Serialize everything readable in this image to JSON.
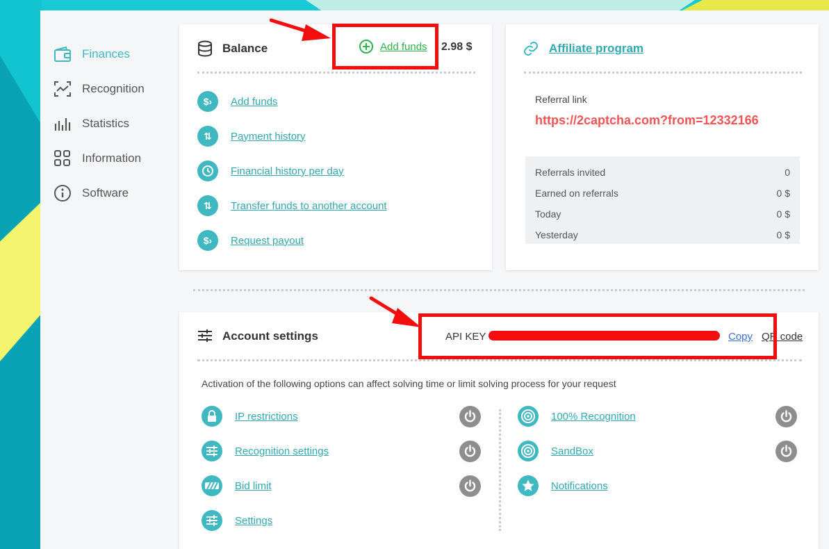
{
  "sidebar": {
    "items": [
      {
        "label": "Finances",
        "icon": "wallet-icon",
        "active": true
      },
      {
        "label": "Recognition",
        "icon": "recognition-icon",
        "active": false
      },
      {
        "label": "Statistics",
        "icon": "bar-chart-icon",
        "active": false
      },
      {
        "label": "Information",
        "icon": "grid-icon",
        "active": false
      },
      {
        "label": "Software",
        "icon": "info-icon",
        "active": false
      }
    ]
  },
  "balance": {
    "title": "Balance",
    "add_funds_label": "Add funds",
    "amount": "2.98 $",
    "links": [
      "Add funds",
      "Payment history",
      "Financial history per day",
      "Transfer funds to another account",
      "Request payout"
    ]
  },
  "affiliate": {
    "title": "Affiliate program",
    "referral_label": "Referral link",
    "referral_url": "https://2captcha.com?from=12332166",
    "stats": [
      {
        "label": "Referrals invited",
        "value": "0"
      },
      {
        "label": "Earned on referrals",
        "value": "0 $"
      },
      {
        "label": "Today",
        "value": "0 $"
      },
      {
        "label": "Yesterday",
        "value": "0 $"
      }
    ]
  },
  "settings": {
    "title": "Account settings",
    "api_key_label": "API KEY",
    "copy_label": "Copy",
    "qr_label": "QR code",
    "notice": "Activation of the following options can affect solving time or limit solving process for your request",
    "left_options": [
      "IP restrictions",
      "Recognition settings",
      "Bid limit",
      "Settings"
    ],
    "right_options": [
      "100% Recognition",
      "SandBox",
      "Notifications"
    ]
  },
  "colors": {
    "accent": "#3fb8c1",
    "highlight_red": "#f20e0e",
    "url_red": "#f05454",
    "add_funds_green": "#2db34a"
  }
}
